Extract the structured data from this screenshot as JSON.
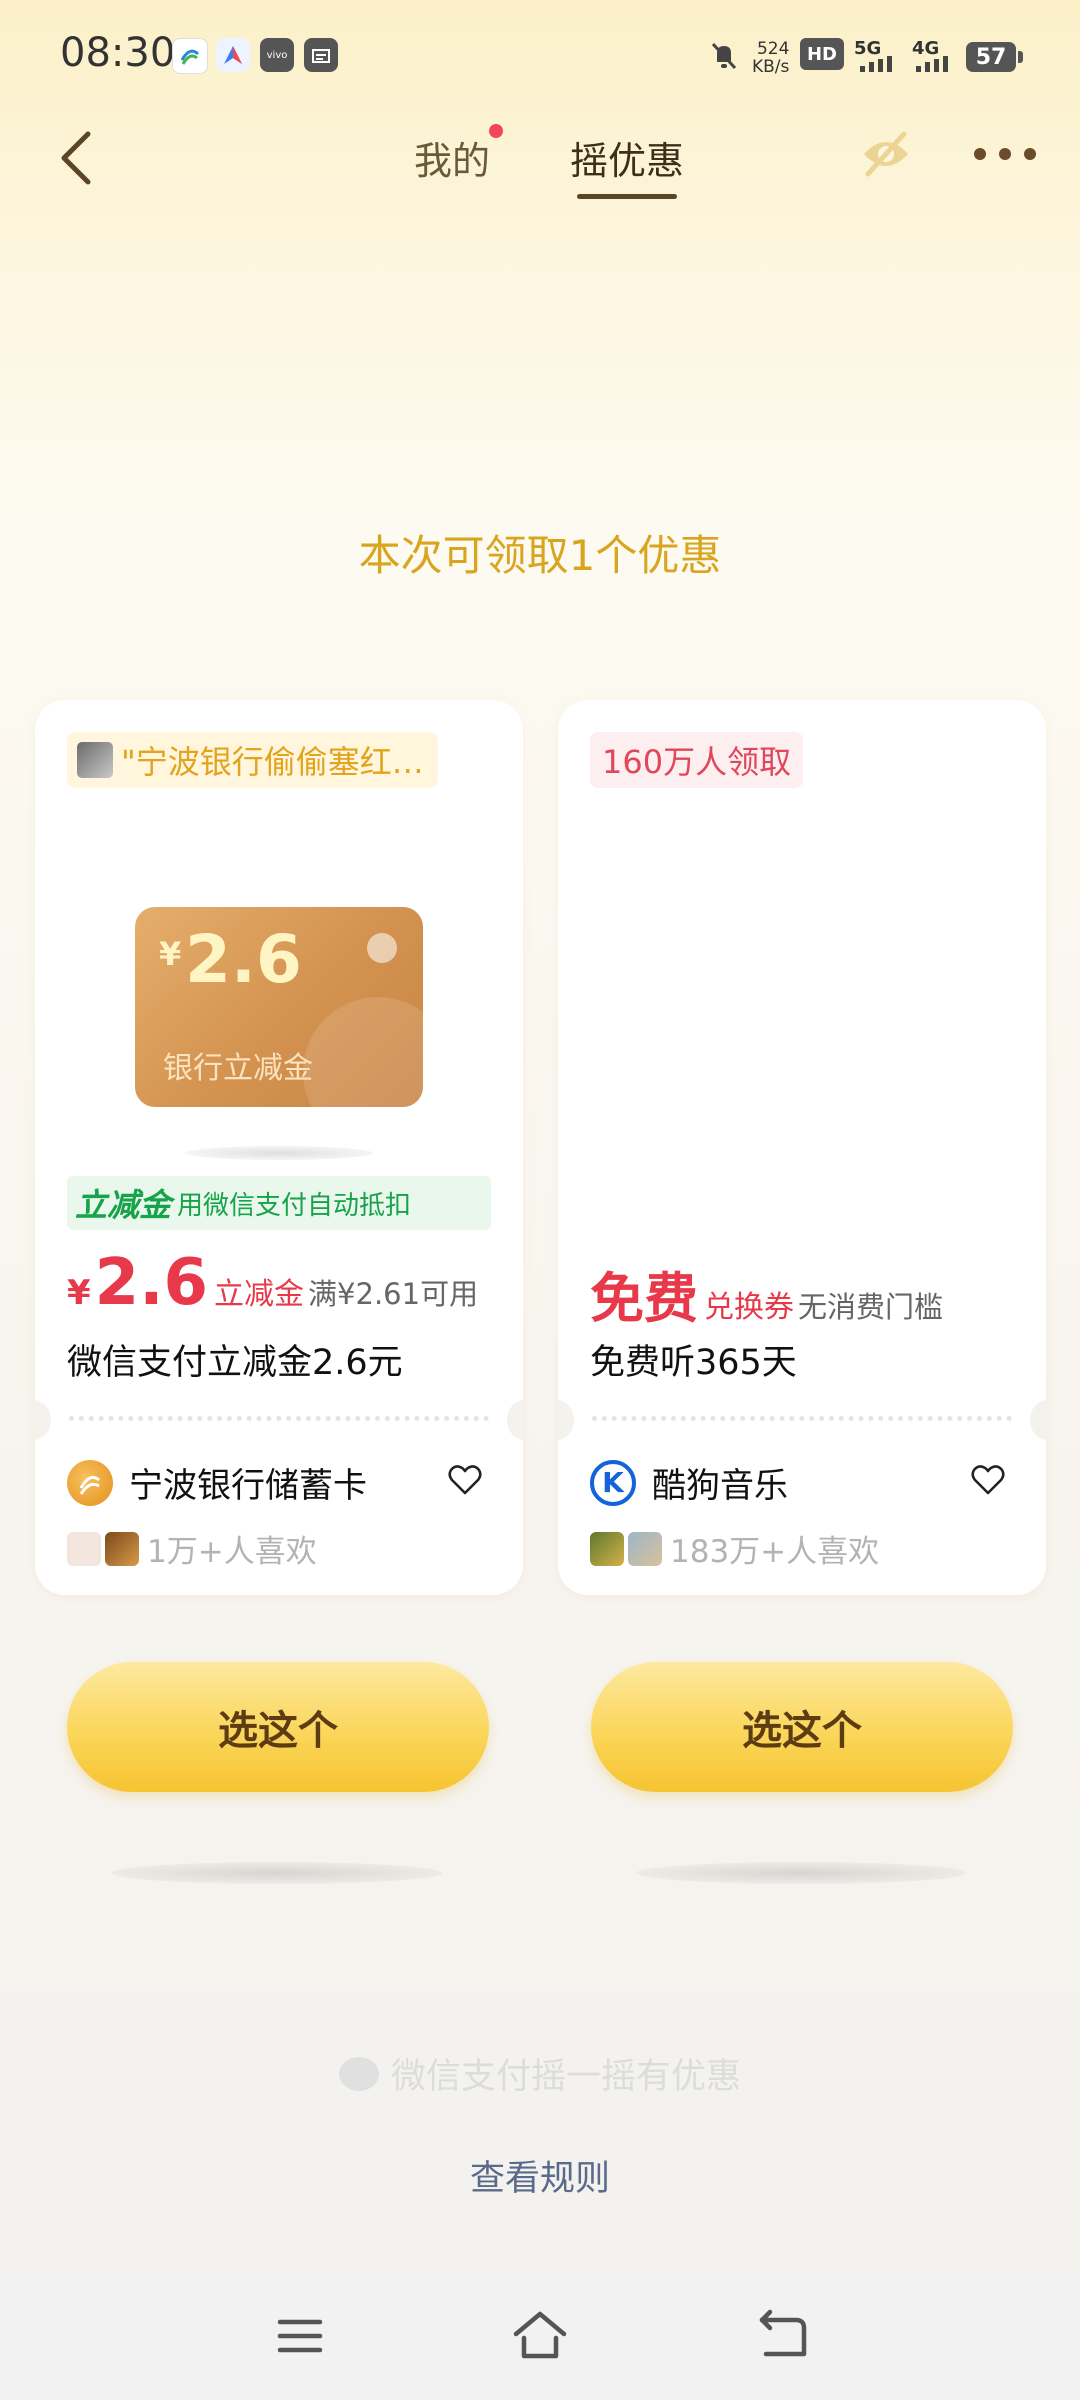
{
  "status_bar": {
    "time": "08:30",
    "network_speed_value": "524",
    "network_speed_unit": "KB/s",
    "hd_label": "HD",
    "signal1_label": "5G",
    "signal2_label": "4G",
    "battery": "57",
    "icons": [
      "china-mobile-icon",
      "browser-icon",
      "vivo-icon",
      "calendar-icon",
      "mute-icon",
      "signal-icon",
      "battery-icon"
    ]
  },
  "nav": {
    "tab_mine": "我的",
    "tab_shake": "摇优惠",
    "active_tab": "摇优惠",
    "accent": "#5b4526",
    "dot_color": "#f2445a"
  },
  "headline": "本次可领取1个优惠",
  "cards": [
    {
      "tag": "\"宁波银行偷偷塞红…",
      "coupon_art_yen": "¥",
      "coupon_art_amount": "2.6",
      "coupon_art_label": "银行立减金",
      "strip_title": "立减金",
      "strip_desc": "用微信支付自动抵扣",
      "price_yen": "¥",
      "price_value": "2.6",
      "price_type": "立减金",
      "price_condition": "满¥2.61可用",
      "title": "微信支付立减金2.6元",
      "brand": "宁波银行储蓄卡",
      "likes": "1万+人喜欢"
    },
    {
      "tag": "160万人领取",
      "price_value": "免费",
      "price_type": "兑换券",
      "price_condition": "无消费门槛",
      "title": "免费听365天",
      "brand": "酷狗音乐",
      "brand_logo_letter": "K",
      "likes": "183万+人喜欢"
    }
  ],
  "buttons": {
    "pick": "选这个"
  },
  "footer": {
    "brand_line": "微信支付摇一摇有优惠",
    "rules_link": "查看规则"
  },
  "colors": {
    "price_red": "#e8394a",
    "headline_gold": "#d9a51f",
    "button_yellow": "#fbd65a"
  }
}
